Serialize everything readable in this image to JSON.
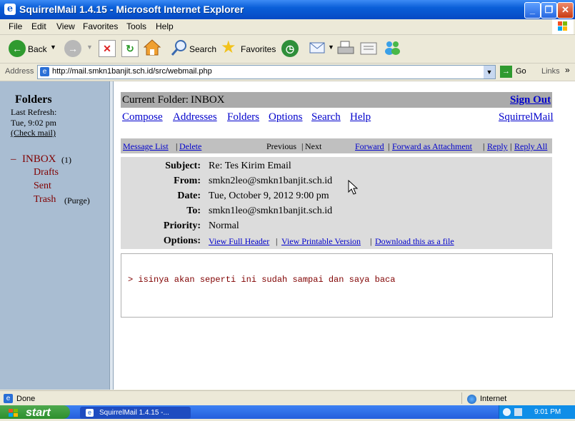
{
  "window": {
    "title": "SquirrelMail 1.4.15 - Microsoft Internet Explorer"
  },
  "menu": [
    "File",
    "Edit",
    "View",
    "Favorites",
    "Tools",
    "Help"
  ],
  "toolbar": {
    "back": "Back",
    "search": "Search",
    "favorites": "Favorites"
  },
  "address": {
    "label": "Address",
    "url": "http://mail.smkn1banjit.sch.id/src/webmail.php",
    "go": "Go",
    "links": "Links"
  },
  "folders": {
    "heading": "Folders",
    "refresh_label": "Last Refresh:",
    "refresh_time": "Tue, 9:02 pm",
    "check_mail": "(Check mail)",
    "inbox": "INBOX",
    "inbox_count": "(1)",
    "drafts": "Drafts",
    "sent": "Sent",
    "trash": "Trash",
    "purge": "(Purge)",
    "bullet": "–"
  },
  "header": {
    "current_folder_label": "Current Folder:",
    "current_folder": "INBOX",
    "sign_out": "Sign Out",
    "nav": [
      "Compose",
      "Addresses",
      "Folders",
      "Options",
      "Search",
      "Help"
    ],
    "brand": "SquirrelMail"
  },
  "message_bar": {
    "message_list": "Message List",
    "delete": "Delete",
    "previous": "Previous",
    "next": "Next",
    "forward": "Forward",
    "forward_attachment": "Forward as Attachment",
    "reply": "Reply",
    "reply_all": "Reply All",
    "sep": "|"
  },
  "message": {
    "subject_label": "Subject:",
    "subject": "Re: Tes Kirim Email",
    "from_label": "From:",
    "from": "smkn2leo@smkn1banjit.sch.id",
    "date_label": "Date:",
    "date": "Tue, October 9, 2012 9:00 pm",
    "to_label": "To:",
    "to": "smkn1leo@smkn1banjit.sch.id",
    "priority_label": "Priority:",
    "priority": "Normal",
    "options_label": "Options:",
    "view_full_header": "View Full Header",
    "view_printable": "View Printable Version",
    "download_file": "Download this as a file",
    "body": "> isinya akan seperti ini sudah sampai dan saya baca"
  },
  "status": {
    "left": "Done",
    "zone": "Internet"
  },
  "taskbar": {
    "start": "start",
    "task": "SquirrelMail 1.4.15 -...",
    "clock": "9:01 PM"
  }
}
